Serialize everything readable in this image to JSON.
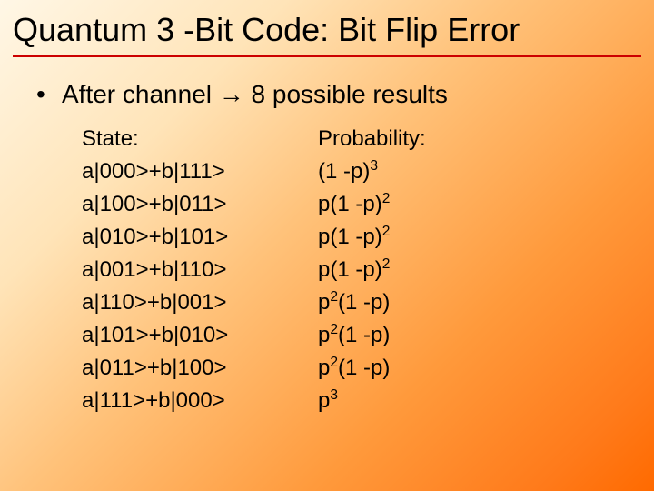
{
  "title": "Quantum 3 -Bit Code: Bit Flip Error",
  "bullet": {
    "prefix": "After channel ",
    "arrow": "→",
    "suffix": " 8 possible results"
  },
  "headers": {
    "state": "State:",
    "prob": "Probability:"
  },
  "rows": [
    {
      "state": "a|000>+b|111>",
      "prob_html": "(1 -p)<sup>3</sup>"
    },
    {
      "state": "a|100>+b|011>",
      "prob_html": "p(1 -p)<sup>2</sup>"
    },
    {
      "state": "a|010>+b|101>",
      "prob_html": "p(1 -p)<sup>2</sup>"
    },
    {
      "state": "a|001>+b|110>",
      "prob_html": "p(1 -p)<sup>2</sup>"
    },
    {
      "state": "a|110>+b|001>",
      "prob_html": "p<sup>2</sup>(1 -p)"
    },
    {
      "state": "a|101>+b|010>",
      "prob_html": "p<sup>2</sup>(1 -p)"
    },
    {
      "state": "a|011>+b|100>",
      "prob_html": "p<sup>2</sup>(1 -p)"
    },
    {
      "state": "a|111>+b|000>",
      "prob_html": "p<sup>3</sup>"
    }
  ]
}
